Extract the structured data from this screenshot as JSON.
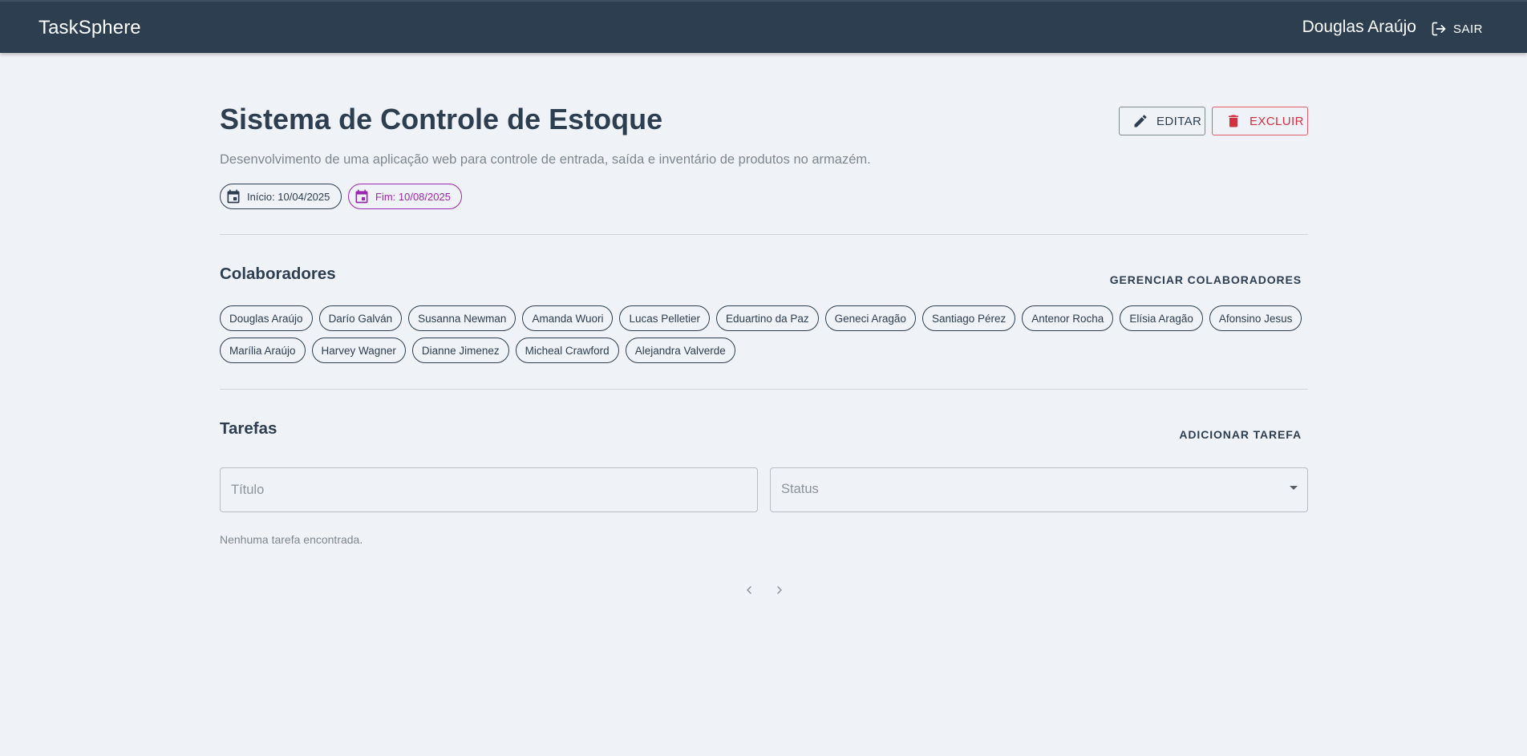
{
  "appbar": {
    "brand": "TaskSphere",
    "user_name": "Douglas Araújo",
    "logout_label": "SAIR"
  },
  "project": {
    "title": "Sistema de Controle de Estoque",
    "description": "Desenvolvimento de uma aplicação web para controle de entrada, saída e inventário de produtos no armazém.",
    "start_label": "Início: 10/04/2025",
    "end_label": "Fim: 10/08/2025",
    "edit_label": "EDITAR",
    "delete_label": "EXCLUIR"
  },
  "collaborators": {
    "title": "Colaboradores",
    "manage_label": "GERENCIAR COLABORADORES",
    "names": [
      "Douglas Araújo",
      "Darío Galván",
      "Susanna Newman",
      "Amanda Wuori",
      "Lucas Pelletier",
      "Eduartino da Paz",
      "Geneci Aragão",
      "Santiago Pérez",
      "Antenor Rocha",
      "Elísia Aragão",
      "Afonsino Jesus",
      "Marília Araújo",
      "Harvey Wagner",
      "Dianne Jimenez",
      "Micheal Crawford",
      "Alejandra Valverde"
    ]
  },
  "tasks": {
    "title": "Tarefas",
    "add_label": "ADICIONAR TAREFA",
    "title_placeholder": "Título",
    "status_label": "Status",
    "empty_message": "Nenhuma tarefa encontrada."
  },
  "colors": {
    "appbar": "#2c3e50",
    "background": "#eff2f7",
    "danger": "#d32f3f",
    "end_date": "#9c27b0"
  },
  "icons": {
    "logout": "logout-icon",
    "edit": "pencil-icon",
    "delete": "trash-icon",
    "date": "calendar-icon",
    "prev": "chevron-left-icon",
    "next": "chevron-right-icon"
  }
}
